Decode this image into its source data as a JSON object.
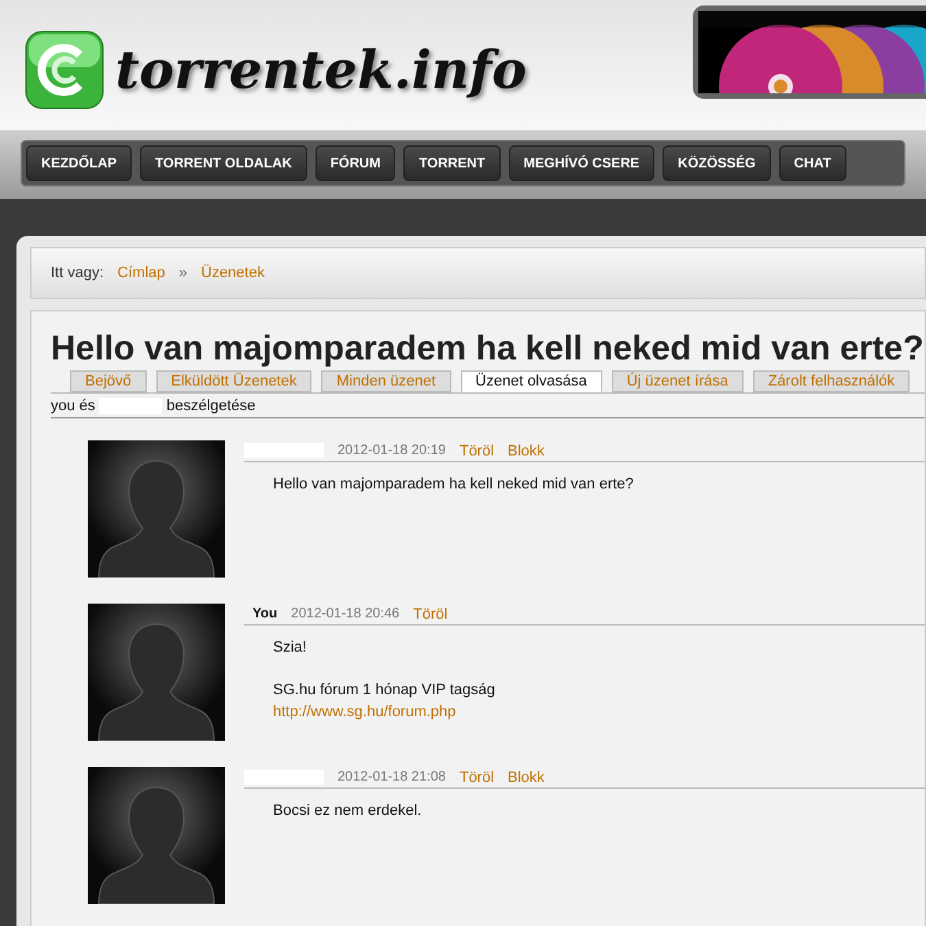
{
  "site": {
    "logo_text": "torrentek.info"
  },
  "nav": [
    {
      "label": "KEZDŐLAP"
    },
    {
      "label": "TORRENT OLDALAK"
    },
    {
      "label": "FÓRUM"
    },
    {
      "label": "TORRENT"
    },
    {
      "label": "MEGHÍVÓ CSERE"
    },
    {
      "label": "KÖZÖSSÉG"
    },
    {
      "label": "CHAT"
    }
  ],
  "breadcrumb": {
    "label": "Itt vagy:",
    "items": [
      "Címlap",
      "Üzenetek"
    ],
    "separator": "»"
  },
  "title": "Hello van majomparadem ha kell neked mid van erte?",
  "tabs": [
    {
      "label": "Bejövő",
      "selected": false
    },
    {
      "label": "Elküldött Üzenetek",
      "selected": false
    },
    {
      "label": "Minden üzenet",
      "selected": false
    },
    {
      "label": "Üzenet olvasása",
      "selected": true
    },
    {
      "label": "Új üzenet írása",
      "selected": false
    },
    {
      "label": "Zárolt felhasználók",
      "selected": false
    }
  ],
  "conversation": {
    "prefix": "you és",
    "suffix": "beszélgetése"
  },
  "messages": [
    {
      "time": "2012-01-18 20:19",
      "actions": [
        "Töröl",
        "Blokk"
      ],
      "paragraphs": [
        [
          {
            "kind": "text",
            "text": "Hello van majomparadem ha kell neked mid van erte?"
          }
        ]
      ]
    },
    {
      "author": "You",
      "time": "2012-01-18 20:46",
      "actions": [
        "Töröl"
      ],
      "paragraphs": [
        [
          {
            "kind": "text",
            "text": "Szia!"
          }
        ],
        [
          {
            "kind": "text",
            "text": "SG.hu fórum 1 hónap VIP tagság"
          },
          {
            "kind": "link",
            "text": "http://www.sg.hu/forum.php"
          }
        ]
      ]
    },
    {
      "time": "2012-01-18 21:08",
      "actions": [
        "Töröl",
        "Blokk"
      ],
      "paragraphs": [
        [
          {
            "kind": "text",
            "text": "Bocsi ez nem erdekel."
          }
        ]
      ]
    }
  ]
}
